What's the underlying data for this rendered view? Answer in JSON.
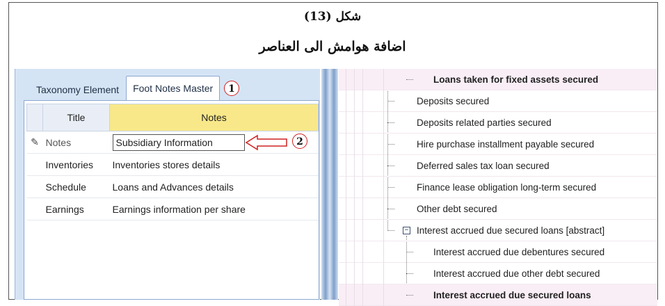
{
  "caption": {
    "figure_label": "شكل (13)",
    "subtitle": "اضافة هوامش الى العناصر"
  },
  "tabs": [
    {
      "label": "Taxonomy Element",
      "active": false
    },
    {
      "label": "Foot Notes Master",
      "active": true
    }
  ],
  "markers": {
    "one": "1",
    "two": "2"
  },
  "grid": {
    "headers": {
      "title": "Title",
      "notes": "Notes"
    },
    "rows": [
      {
        "selector": "✎",
        "title": "Notes",
        "notes": "Subsidiary Information"
      },
      {
        "selector": "",
        "title": "Inventories",
        "notes": "Inventories stores details"
      },
      {
        "selector": "",
        "title": "Schedule",
        "notes": "Loans and Advances details"
      },
      {
        "selector": "",
        "title": "Earnings",
        "notes": "Earnings information per share"
      }
    ]
  },
  "tree": {
    "items": [
      {
        "label": "Loans taken for fixed assets secured"
      },
      {
        "label": "Deposits secured"
      },
      {
        "label": "Deposits related parties secured"
      },
      {
        "label": "Hire purchase installment payable secured"
      },
      {
        "label": "Deferred sales tax loan secured"
      },
      {
        "label": "Finance lease obligation long-term secured"
      },
      {
        "label": "Other debt secured"
      },
      {
        "label": "Interest accrued due secured loans [abstract]",
        "expander": "−"
      },
      {
        "label": "Interest accrued due debentures secured"
      },
      {
        "label": "Interest accrued due other debt secured"
      },
      {
        "label": "Interest accrued due secured loans"
      }
    ]
  },
  "colors": {
    "notes_header": "#f8e889",
    "marker_border": "#d02020",
    "pane_bg": "#d5e4f5"
  }
}
